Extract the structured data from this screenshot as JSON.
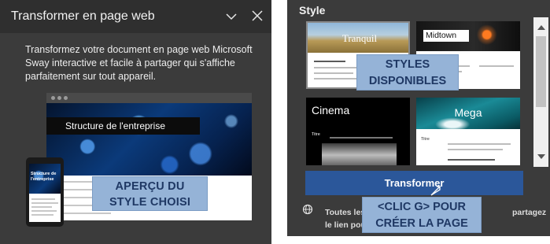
{
  "left_panel": {
    "title": "Transformer en page web",
    "description": "Transformez votre document en page web Microsoft Sway interactive et facile à partager qui s'affiche parfaitement sur tout appareil.",
    "preview": {
      "laptop_heading": "Structure de l'entreprise",
      "phone_heading": "Structure de l'entreprise"
    },
    "annotation": {
      "line1": "APERÇU DU",
      "line2": "STYLE CHOISI"
    }
  },
  "right_panel": {
    "section_label": "Style",
    "styles": [
      {
        "name": "Tranquil"
      },
      {
        "name": "Midtown"
      },
      {
        "name": "Cinema",
        "subtitle": "Titre"
      },
      {
        "name": "Mega",
        "subtitle": "Titre"
      }
    ],
    "styles_annotation": {
      "line1": "STYLES",
      "line2": "DISPONIBLES"
    },
    "transform_button": "Transformer",
    "share_note": {
      "line1_start": "Toutes les",
      "line1_end": "partagez",
      "line2": "le lien pourront a"
    },
    "click_annotation": {
      "line1": "<CLIC G> POUR",
      "line2": "CRÉER LA PAGE"
    }
  },
  "colors": {
    "panel_bg": "#3b3b3b",
    "header_bg": "#2f2f2f",
    "button_blue": "#2b579a",
    "callout_fill": "#95b3d7",
    "callout_text": "#1f3864"
  },
  "icons": {
    "collapse": "chevron-down-icon",
    "close": "close-icon",
    "globe": "globe-icon",
    "cursor": "mouse-cursor-icon"
  }
}
